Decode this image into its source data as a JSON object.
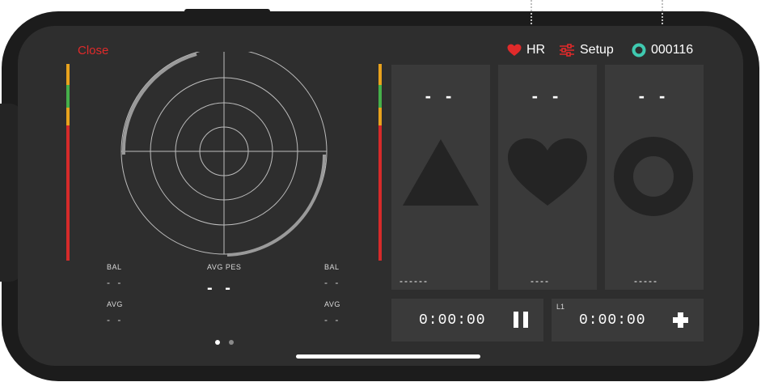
{
  "header": {
    "close_label": "Close",
    "hr_label": "HR",
    "setup_label": "Setup",
    "device_id": "000116"
  },
  "icons": {
    "heart": "heart-icon",
    "setup": "sliders-icon",
    "device": "ring-icon"
  },
  "colors": {
    "accent_red": "#e02a2a",
    "device_teal": "#3fc9b0",
    "level_orange": "#e8a21d",
    "level_green": "#46b04a",
    "level_red": "#d62a2a"
  },
  "stats": {
    "bal_left_label": "BAL",
    "bal_left_value": "- -",
    "avg_left_label": "AVG",
    "avg_left_value": "- -",
    "avg_pes_label": "AVG PES",
    "avg_pes_value": "- -",
    "bal_right_label": "BAL",
    "bal_right_value": "- -",
    "avg_right_label": "AVG",
    "avg_right_value": "- -"
  },
  "zones": [
    {
      "top_value": "- -",
      "icon": "triangle-icon",
      "bottom_value": "------"
    },
    {
      "top_value": "- -",
      "icon": "heart-icon",
      "bottom_value": "----"
    },
    {
      "top_value": "- -",
      "icon": "ring-icon",
      "bottom_value": "-----"
    }
  ],
  "timers": {
    "main_time": "0:00:00",
    "lap_label": "L1",
    "lap_time": "0:00:00"
  },
  "pager": {
    "count": 2,
    "active_index": 0
  }
}
